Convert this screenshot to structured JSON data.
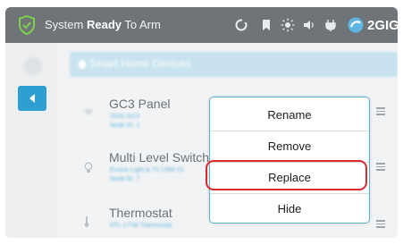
{
  "status_bar": {
    "prefix": "System",
    "state": "Ready",
    "suffix": "To Arm",
    "brand": "2GIG"
  },
  "header": {
    "title": "Smart Home Devices"
  },
  "devices": [
    {
      "name": "GC3 Panel",
      "line1": "2GIG GC3",
      "line2": "Node ID: 1"
    },
    {
      "name": "Multi Level Switch",
      "line1": "Evolve Light & TV LRM-15",
      "line2": "Node ID: 7"
    },
    {
      "name": "Thermostat",
      "line1": "RTL CT30 Thermostat",
      "line2": ""
    }
  ],
  "menu": {
    "options": [
      "Rename",
      "Remove",
      "Replace",
      "Hide"
    ],
    "highlighted": "Replace"
  },
  "colors": {
    "status_bar": "#6f7479",
    "accent": "#2f9fd2",
    "menu_border": "#5fb2dd",
    "highlight": "#d9292f"
  }
}
